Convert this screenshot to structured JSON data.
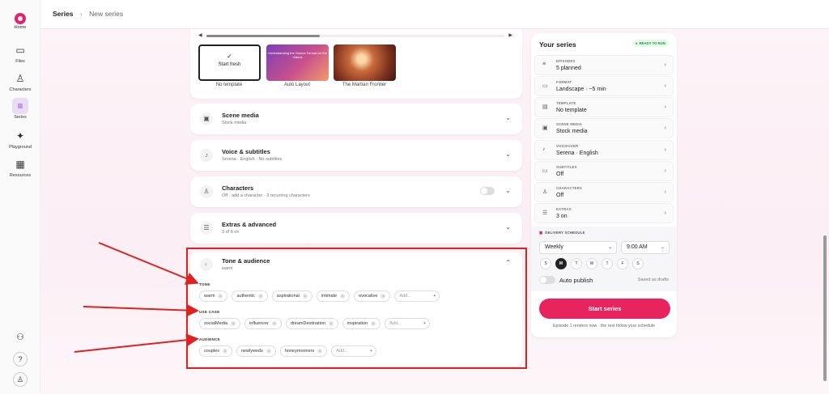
{
  "app": {
    "nav": [
      {
        "label": "Home",
        "icon": "home-icon"
      },
      {
        "label": "Files",
        "icon": "folder-icon"
      },
      {
        "label": "Characters",
        "icon": "person-icon"
      },
      {
        "label": "Series",
        "icon": "series-icon",
        "active": true
      },
      {
        "label": "Playground",
        "icon": "sparkle-icon"
      },
      {
        "label": "Resources",
        "icon": "grid-icon"
      }
    ]
  },
  "breadcrumb": {
    "root": "Series",
    "current": "New series"
  },
  "templates": [
    {
      "label": "No template",
      "tile_text": "Start fresh"
    },
    {
      "label": "Auto Layout",
      "tile_text": "Understanding the Source Format for the Videos"
    },
    {
      "label": "The Martian Frontier",
      "tile_text": ""
    }
  ],
  "sections": [
    {
      "title": "Scene media",
      "subtitle": "Stock media"
    },
    {
      "title": "Voice & subtitles",
      "subtitle": "Serena · English · No subtitles"
    },
    {
      "title": "Characters",
      "subtitle": "Off · add a character · 3 recurring characters"
    },
    {
      "title": "Extras & advanced",
      "subtitle": "3 of 6 on"
    }
  ],
  "tone": {
    "title": "Tone & audience",
    "subtitle": "warm",
    "groups": [
      {
        "label": "TONE",
        "chips": [
          "warm",
          "authentic",
          "aspirational",
          "intimate",
          "evocative"
        ]
      },
      {
        "label": "USE CASE",
        "chips": [
          "socialMedia",
          "influencer",
          "dreamDestination",
          "inspiration"
        ]
      },
      {
        "label": "AUDIENCE",
        "chips": [
          "couples",
          "newlyweds",
          "honeymooners"
        ]
      }
    ],
    "add_placeholder": "Add..."
  },
  "panel": {
    "title": "Your series",
    "badge": "READY TO RUN",
    "rows": [
      {
        "key": "EPISODES",
        "value": "5 planned",
        "icon": "episodes-icon"
      },
      {
        "key": "FORMAT",
        "value": "Landscape · ~5 min",
        "icon": "monitor-icon"
      },
      {
        "key": "TEMPLATE",
        "value": "No template",
        "icon": "template-icon"
      },
      {
        "key": "SCENE MEDIA",
        "value": "Stock media",
        "icon": "image-icon"
      },
      {
        "key": "VOICEOVER",
        "value": "Serena · English",
        "icon": "mic-icon"
      },
      {
        "key": "SUBTITLES",
        "value": "Off",
        "icon": "subtitles-icon"
      },
      {
        "key": "CHARACTERS",
        "value": "Off",
        "icon": "person-icon"
      },
      {
        "key": "EXTRAS",
        "value": "3 on",
        "icon": "sliders-icon"
      }
    ],
    "delivery": {
      "label": "DELIVERY SCHEDULE",
      "frequency": "Weekly",
      "time": "9:00 AM",
      "days": [
        "S",
        "M",
        "T",
        "W",
        "T",
        "F",
        "S"
      ],
      "selected_day_index": 1,
      "auto_publish_label": "Auto publish",
      "auto_publish": false,
      "drafts_note": "Saved as drafts"
    },
    "cta": "Start series",
    "footnote": "Episode 1 renders now · the rest follow your schedule"
  },
  "colors": {
    "accent": "#e8245f",
    "annotation": "#dd2222",
    "ready": "#1a9c3c"
  }
}
